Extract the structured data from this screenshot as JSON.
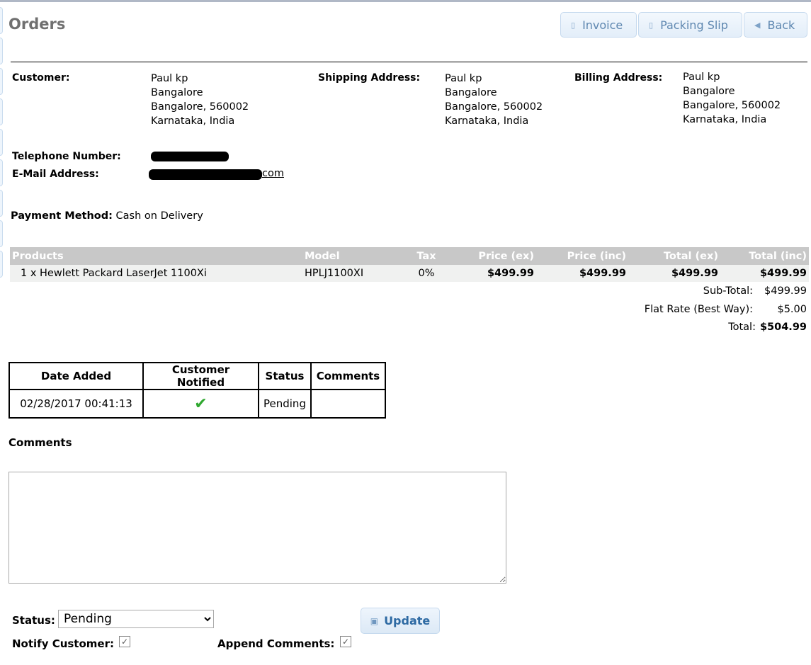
{
  "header": {
    "title": "Orders",
    "buttons": {
      "invoice": "Invoice",
      "packing_slip": "Packing Slip",
      "back": "Back"
    }
  },
  "customer": {
    "label": "Customer:",
    "name": "Paul kp",
    "city": "Bangalore",
    "city_zip": "Bangalore, 560002",
    "state_country": "Karnataka, India"
  },
  "shipping": {
    "label": "Shipping Address:",
    "name": "Paul kp",
    "city": "Bangalore",
    "city_zip": "Bangalore, 560002",
    "state_country": "Karnataka, India"
  },
  "billing": {
    "label": "Billing Address:",
    "name": "Paul kp",
    "city": "Bangalore",
    "city_zip": "Bangalore, 560002",
    "state_country": "Karnataka, India"
  },
  "contact": {
    "telephone_label": "Telephone Number:",
    "email_label": "E-Mail Address:",
    "email_visible_suffix": "com"
  },
  "payment": {
    "label": "Payment Method:",
    "value": "Cash on Delivery"
  },
  "products": {
    "headers": [
      "Products",
      "Model",
      "Tax",
      "Price (ex)",
      "Price (inc)",
      "Total (ex)",
      "Total (inc)"
    ],
    "rows": [
      {
        "product": "1 x Hewlett Packard LaserJet 1100Xi",
        "model": "HPLJ1100XI",
        "tax": "0%",
        "price_ex": "$499.99",
        "price_inc": "$499.99",
        "total_ex": "$499.99",
        "total_inc": "$499.99"
      }
    ]
  },
  "totals": [
    {
      "label": "Sub-Total:",
      "value": "$499.99"
    },
    {
      "label": "Flat Rate (Best Way):",
      "value": "$5.00"
    },
    {
      "label": "Total:",
      "value": "$504.99"
    }
  ],
  "history": {
    "headers": [
      "Date Added",
      "Customer Notified",
      "Status",
      "Comments"
    ],
    "rows": [
      {
        "date": "02/28/2017 00:41:13",
        "notified": true,
        "status": "Pending",
        "comments": ""
      }
    ]
  },
  "comments_form": {
    "title": "Comments",
    "textarea_value": "",
    "status_label": "Status:",
    "status_selected": "Pending",
    "notify_label": "Notify Customer:",
    "notify_checked": true,
    "append_label": "Append Comments:",
    "append_checked": true,
    "update_label": "Update"
  },
  "colors": {
    "check_green": "#2fa82f",
    "button_text": "#5e87b0",
    "table_header_bg": "#c8c8c8"
  }
}
